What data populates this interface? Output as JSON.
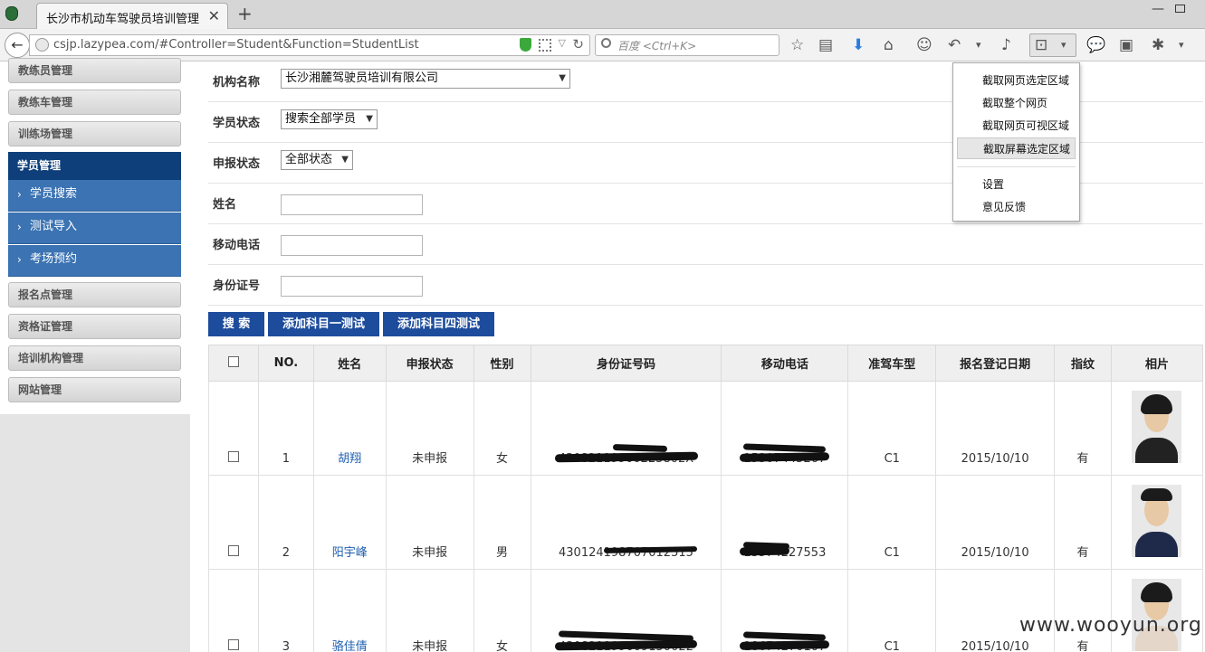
{
  "browser": {
    "tab_title": "长沙市机动车驾驶员培训管理...",
    "tab_close": "✕",
    "new_tab": "+",
    "url": "csjp.lazypea.com/#Controller=Student&Function=StudentList",
    "search_placeholder": "百度 <Ctrl+K>"
  },
  "screenshot_menu": {
    "items": [
      "截取网页选定区域",
      "截取整个网页",
      "截取网页可视区域",
      "截取屏幕选定区域"
    ],
    "extra": [
      "设置",
      "意见反馈"
    ]
  },
  "sidebar": {
    "top_items": [
      "教练员管理",
      "教练车管理",
      "训练场管理"
    ],
    "active": "学员管理",
    "sub_items": [
      "学员搜索",
      "测试导入",
      "考场预约"
    ],
    "bottom_items": [
      "报名点管理",
      "资格证管理",
      "培训机构管理",
      "网站管理"
    ]
  },
  "filters": {
    "org_label": "机构名称",
    "org_value": "长沙湘麓驾驶员培训有限公司",
    "student_status_label": "学员状态",
    "student_status_value": "搜索全部学员",
    "report_status_label": "申报状态",
    "report_status_value": "全部状态",
    "name_label": "姓名",
    "phone_label": "移动电话",
    "id_label": "身份证号"
  },
  "buttons": {
    "search": "搜 索",
    "add_subject1": "添加科目一测试",
    "add_subject4": "添加科目四测试"
  },
  "table": {
    "headers": [
      "NO.",
      "姓名",
      "申报状态",
      "性别",
      "身份证号码",
      "移动电话",
      "准驾车型",
      "报名登记日期",
      "指纹",
      "相片"
    ],
    "rows": [
      {
        "no": "1",
        "name": "胡翔",
        "status": "未申报",
        "gender": "女",
        "id": "43082119900225802X",
        "phone": "15307445267",
        "license": "C1",
        "date": "2015/10/10",
        "fingerprint": "有"
      },
      {
        "no": "2",
        "name": "阳宇峰",
        "status": "未申报",
        "gender": "男",
        "id": "430124198707012515",
        "phone": "13574227553",
        "license": "C1",
        "date": "2015/10/10",
        "fingerprint": "有"
      },
      {
        "no": "3",
        "name": "骆佳倩",
        "status": "未申报",
        "gender": "女",
        "id": "430821199009150022",
        "phone": "18674270107",
        "license": "C1",
        "date": "2015/10/10",
        "fingerprint": "有"
      }
    ]
  },
  "watermark": "www.wooyun.org"
}
